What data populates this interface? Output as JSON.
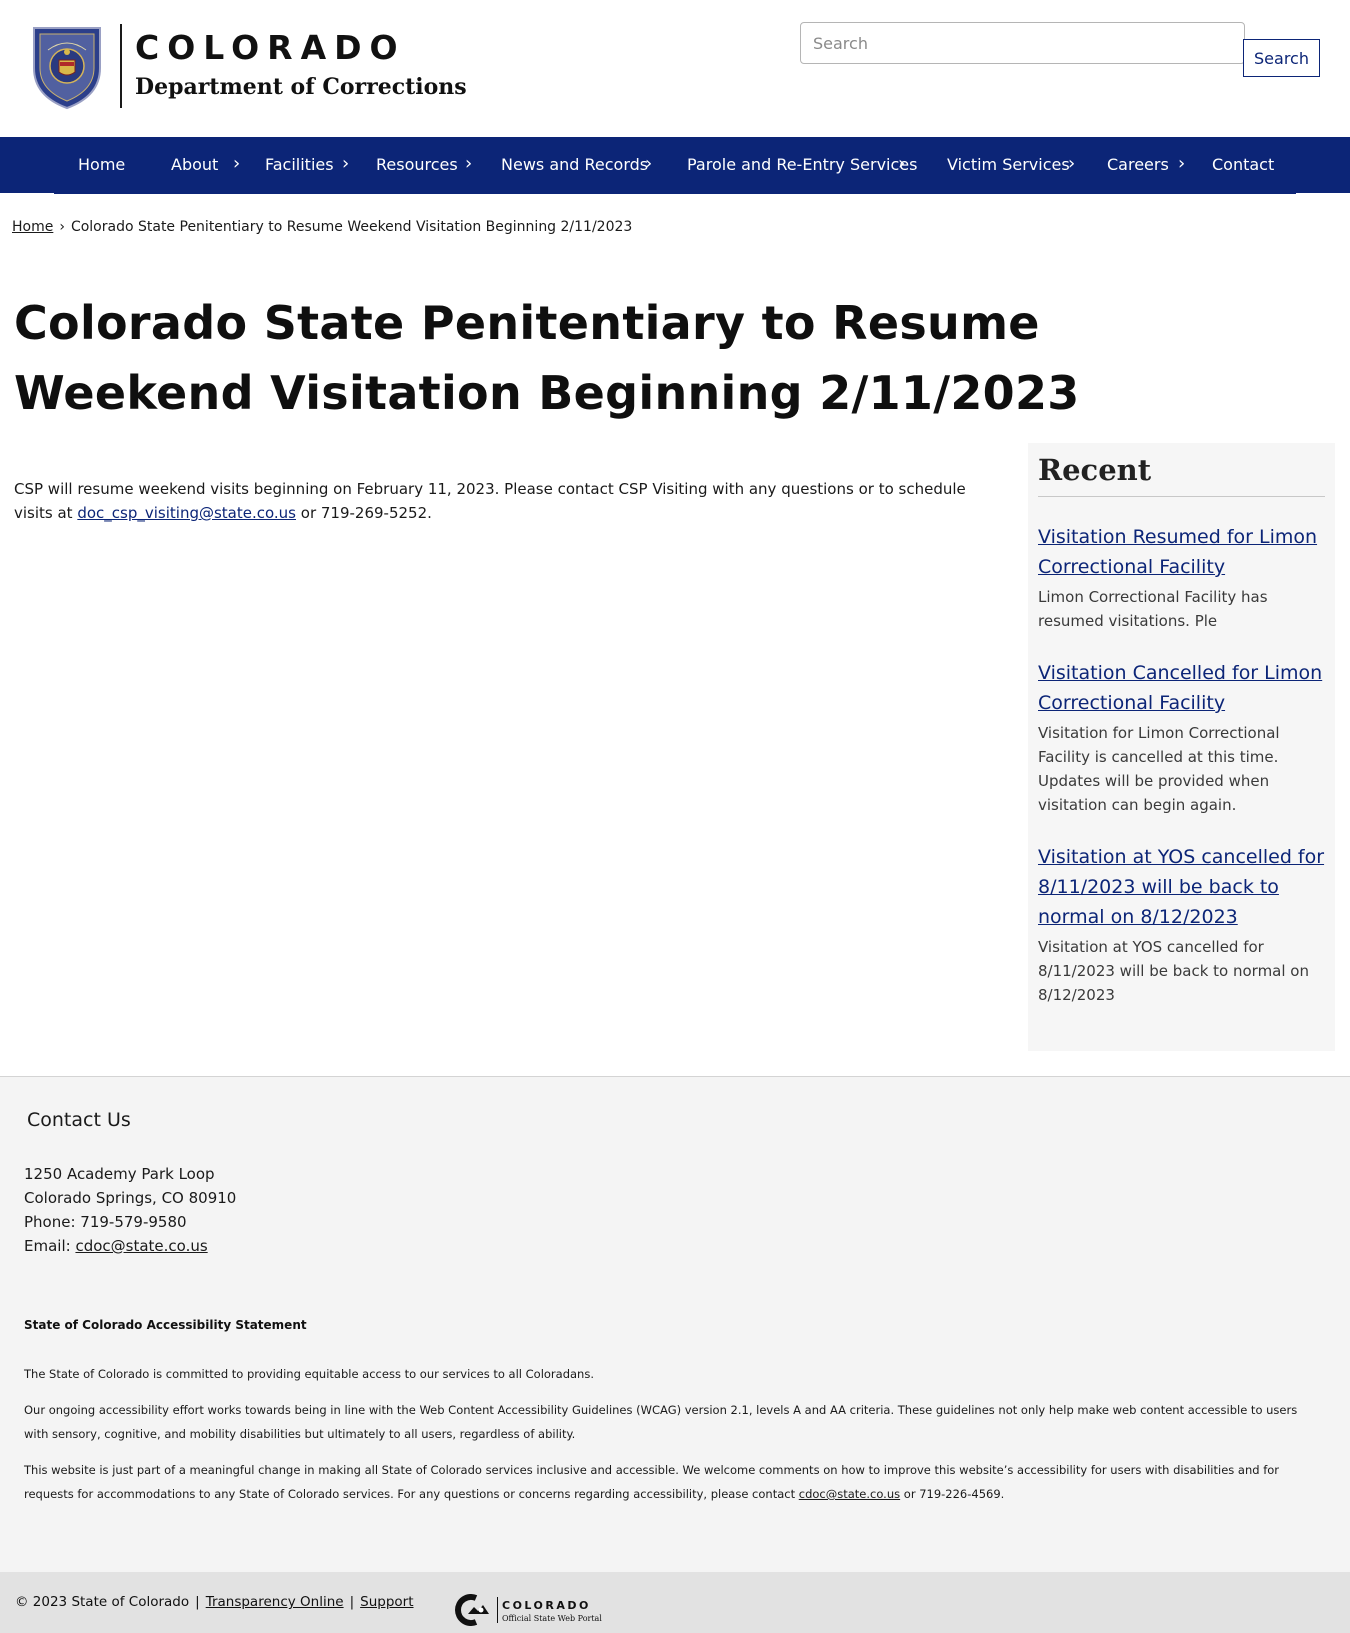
{
  "header": {
    "state_name": "COLORADO",
    "department": "Department of Corrections",
    "seal_text": "COLORADO DEPARTMENT OF CORRECTIONS",
    "search_placeholder": "Search",
    "search_button": "Search"
  },
  "nav": {
    "items": [
      {
        "label": "Home",
        "has_chevron": false
      },
      {
        "label": "About",
        "has_chevron": true
      },
      {
        "label": "Facilities",
        "has_chevron": true
      },
      {
        "label": "Resources",
        "has_chevron": true
      },
      {
        "label": "News and Records",
        "has_chevron": true
      },
      {
        "label": "Parole and Re-Entry Services",
        "has_chevron": true
      },
      {
        "label": "Victim Services",
        "has_chevron": true
      },
      {
        "label": "Careers",
        "has_chevron": true
      },
      {
        "label": "Contact",
        "has_chevron": false
      }
    ],
    "chevron": "›"
  },
  "breadcrumb": {
    "home": "Home",
    "separator": "›",
    "current": "Colorado State Penitentiary to Resume Weekend Visitation Beginning 2/11/2023"
  },
  "page_title": "Colorado State Penitentiary to Resume Weekend Visitation Beginning 2/11/2023",
  "body": {
    "text_before": "CSP will resume weekend visits beginning on February 11, 2023.  Please contact CSP Visiting with any questions or to schedule visits at ",
    "email_link": "doc_csp_visiting@state.co.us",
    "text_after": " or 719-269-5252."
  },
  "sidebar": {
    "heading": "Recent",
    "items": [
      {
        "title": "Visitation Resumed for Limon Correctional Facility",
        "summary": "Limon Correctional Facility has resumed visitations.  Ple"
      },
      {
        "title": "Visitation Cancelled for Limon Correctional Facility",
        "summary": "Visitation for Limon Correctional Facility is cancelled at this time. Updates will be provided when visitation can begin again."
      },
      {
        "title": "Visitation at YOS cancelled for 8/11/2023 will be back to normal on 8/12/2023",
        "summary": "Visitation at YOS cancelled for 8/11/2023 will be back to normal on 8/12/2023"
      }
    ]
  },
  "footer": {
    "contact_heading": "Contact Us",
    "address_line1": "1250 Academy Park Loop",
    "address_line2": "Colorado Springs, CO 80910",
    "phone": "Phone: 719-579-9580",
    "email_label": "Email: ",
    "email": "cdoc@state.co.us",
    "accessibility_heading": "State of Colorado Accessibility Statement",
    "accessibility_p1": "The State of Colorado is committed to providing equitable access to our services to all Coloradans.",
    "accessibility_p2": "Our ongoing accessibility effort works towards being in line with the Web Content Accessibility Guidelines (WCAG) version 2.1, levels A and AA criteria. These guidelines not only help make web content accessible to users with sensory, cognitive, and mobility disabilities but ultimately to all users, regardless of ability.",
    "accessibility_p3_before": "This website is just part of a meaningful change in making all State of Colorado services inclusive and accessible. We welcome comments on how to improve this website’s accessibility for users with disabilities and for requests for accommodations to any State of Colorado services. For any questions or concerns regarding accessibility, please contact ",
    "accessibility_p3_email": "cdoc@state.co.us",
    "accessibility_p3_after": " or 719-226-4569.",
    "copyright": "© 2023 State of Colorado",
    "separator": "|",
    "transparency": "Transparency Online",
    "support": "Support",
    "portal_state": "COLORADO",
    "portal_sub": "Official State Web Portal"
  },
  "colors": {
    "nav_background": "#0c2577",
    "link": "#0c2577",
    "sidebar_background": "#f6f6f6",
    "footer_background": "#f4f4f4",
    "bottom_bar": "#e2e2e2"
  }
}
